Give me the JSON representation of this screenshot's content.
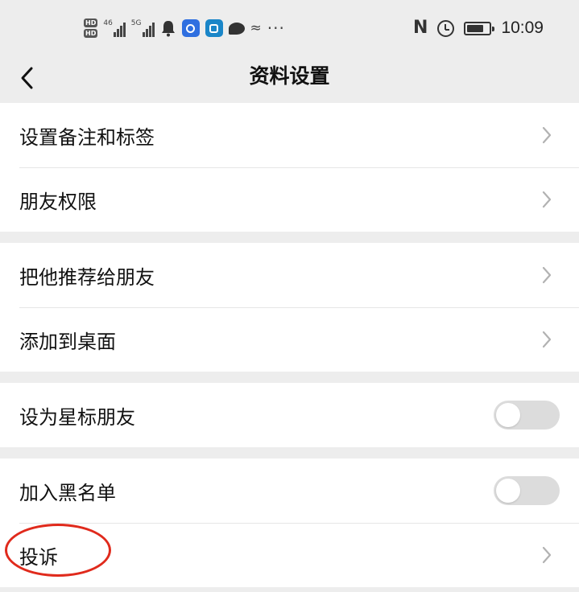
{
  "status_bar": {
    "hd_badges": [
      "HD",
      "HD"
    ],
    "network_1_label": "46",
    "network_2_label": "5G",
    "signal_glyph": "≈",
    "more_dots": "···",
    "nfc_label": "N",
    "battery_level": 0.75,
    "time": "10:09",
    "icons": [
      "hd-icon",
      "signal-icon",
      "bell-icon",
      "app-blue-icon",
      "app-teal-icon",
      "chat-bubble-icon",
      "wifi-off-icon",
      "more-icon",
      "nfc-icon",
      "alarm-icon",
      "battery-icon"
    ]
  },
  "title_bar": {
    "back_icon": "chevron-left-icon",
    "title": "资料设置"
  },
  "groups": [
    {
      "items": [
        {
          "label": "设置备注和标签",
          "control": "chevron"
        },
        {
          "label": "朋友权限",
          "control": "chevron"
        }
      ]
    },
    {
      "items": [
        {
          "label": "把他推荐给朋友",
          "control": "chevron"
        },
        {
          "label": "添加到桌面",
          "control": "chevron"
        }
      ]
    },
    {
      "items": [
        {
          "label": "设为星标朋友",
          "control": "toggle",
          "on": false
        }
      ]
    },
    {
      "items": [
        {
          "label": "加入黑名单",
          "control": "toggle",
          "on": false
        },
        {
          "label": "投诉",
          "control": "chevron",
          "highlighted": true
        }
      ]
    }
  ],
  "colors": {
    "background": "#ededed",
    "row_background": "#ffffff",
    "toggle_off": "#dcdcdc",
    "highlight_ring": "#e02a1c"
  }
}
